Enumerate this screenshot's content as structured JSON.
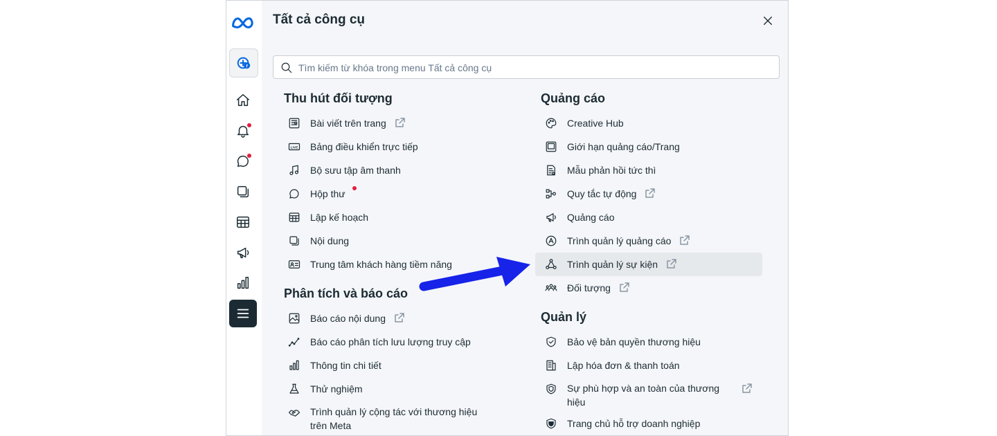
{
  "header": {
    "title": "Tất cả công cụ"
  },
  "search": {
    "placeholder": "Tìm kiếm từ khóa trong menu Tất cả công cụ"
  },
  "sidebar": {
    "items": [
      {
        "icon": "meta-logo-icon"
      },
      {
        "icon": "create-post-icon"
      },
      {
        "icon": "home-icon"
      },
      {
        "icon": "bell-icon"
      },
      {
        "icon": "chat-icon"
      },
      {
        "icon": "content-icon"
      },
      {
        "icon": "planner-icon"
      },
      {
        "icon": "megaphone-icon"
      },
      {
        "icon": "insights-icon"
      },
      {
        "icon": "menu-icon"
      }
    ]
  },
  "sections": {
    "engage": {
      "title": "Thu hút đối tượng",
      "items": [
        {
          "label": "Bài viết trên trang",
          "icon": "posts-icon",
          "external": true
        },
        {
          "label": "Bảng điều khiển trực tiếp",
          "icon": "live-icon"
        },
        {
          "label": "Bộ sưu tập âm thanh",
          "icon": "music-note-icon"
        },
        {
          "label": "Hộp thư",
          "icon": "chat-bubble-icon",
          "notification": true
        },
        {
          "label": "Lập kế hoạch",
          "icon": "calendar-grid-icon"
        },
        {
          "label": "Nội dung",
          "icon": "content-stack-icon"
        },
        {
          "label": "Trung tâm khách hàng tiềm năng",
          "icon": "id-card-icon"
        }
      ]
    },
    "analytics": {
      "title": "Phân tích và báo cáo",
      "items": [
        {
          "label": "Báo cáo nội dung",
          "icon": "image-report-icon",
          "external": true
        },
        {
          "label": "Báo cáo phân tích lưu lượng truy cập",
          "icon": "trend-line-icon"
        },
        {
          "label": "Thông tin chi tiết",
          "icon": "bar-chart-icon"
        },
        {
          "label": "Thử nghiệm",
          "icon": "flask-icon"
        },
        {
          "label": "Trình quản lý cộng tác với thương hiệu trên Meta",
          "icon": "handshake-icon"
        }
      ]
    },
    "ads": {
      "title": "Quảng cáo",
      "items": [
        {
          "label": "Creative Hub",
          "icon": "palette-icon"
        },
        {
          "label": "Giới hạn quảng cáo/Trang",
          "icon": "screen-icon"
        },
        {
          "label": "Mẫu phản hồi tức thì",
          "icon": "form-icon"
        },
        {
          "label": "Quy tắc tự động",
          "icon": "flow-icon",
          "external": true
        },
        {
          "label": "Quảng cáo",
          "icon": "megaphone-icon"
        },
        {
          "label": "Trình quản lý quảng cáo",
          "icon": "ads-manager-icon",
          "external": true
        },
        {
          "label": "Trình quản lý sự kiện",
          "icon": "events-icon",
          "external": true,
          "highlighted": true
        },
        {
          "label": "Đối tượng",
          "icon": "audience-icon",
          "external": true
        }
      ]
    },
    "manage": {
      "title": "Quản lý",
      "items": [
        {
          "label": "Bảo vệ bản quyền thương hiệu",
          "icon": "shield-check-icon"
        },
        {
          "label": "Lập hóa đơn & thanh toán",
          "icon": "billing-icon"
        },
        {
          "label": "Sự phù hợp và an toàn của thương hiệu",
          "icon": "shield-icon",
          "external": true
        },
        {
          "label": "Trang chủ hỗ trợ doanh nghiệp",
          "icon": "support-shield-icon"
        }
      ]
    }
  },
  "colors": {
    "accent_arrow": "#1723e8",
    "notification": "#e41e3f",
    "meta_blue": "#0668e1"
  }
}
